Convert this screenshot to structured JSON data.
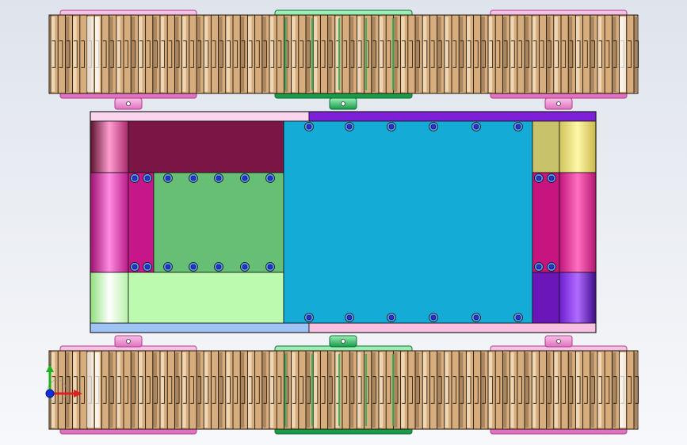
{
  "viewport": {
    "background_top": "#dfe4ec",
    "background_bottom": "#f7f8fb"
  },
  "colors": {
    "track_base": "#d8ad7d",
    "track_dark": "#9a7a55",
    "track_light": "#f7e6c9",
    "track_line": "#1a1208",
    "wheel_pink": "#f3a6d8",
    "wheel_green": "#29b35a",
    "chassis_outline": "#111111",
    "bolt": "#2a2fd6"
  },
  "triad": {
    "x_axis_color": "#e02020",
    "y_axis_color": "#20b020",
    "z_axis_color": "#1030e0",
    "icon": "coordinate-triad-icon"
  }
}
